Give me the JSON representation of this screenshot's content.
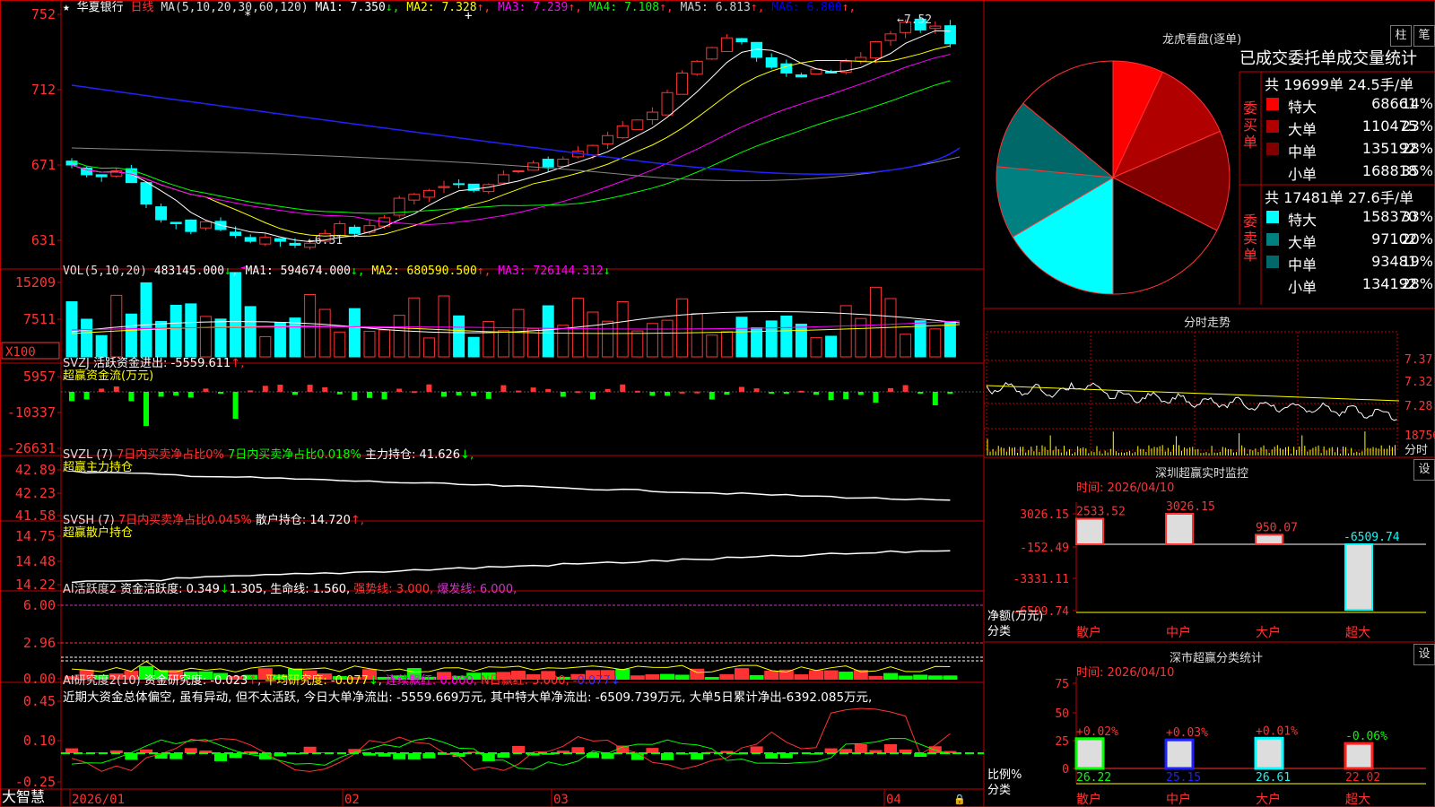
{
  "stock": {
    "name": "华夏银行",
    "period": "日线",
    "star": "★"
  },
  "colors": {
    "up": "#ff3333",
    "down": "#00ffff",
    "grid": "#c00000",
    "bg": "#000000",
    "ma1": "#ffffff",
    "ma2": "#ffff00",
    "ma3": "#ff00ff",
    "ma4": "#00ff00",
    "ma5": "#808080",
    "ma6": "#0000ff"
  },
  "main": {
    "ma_title": "MA(5,10,20,30,60,120)",
    "ma": [
      {
        "label": "MA1:",
        "value": "7.350",
        "arrow": "↓",
        "color": "#ffffff"
      },
      {
        "label": "MA2:",
        "value": "7.328",
        "arrow": "↑",
        "color": "#ffff00"
      },
      {
        "label": "MA3:",
        "value": "7.239",
        "arrow": "↑",
        "color": "#ff00ff"
      },
      {
        "label": "MA4:",
        "value": "7.108",
        "arrow": "↑",
        "color": "#00ff00"
      },
      {
        "label": "MA5:",
        "value": "6.813",
        "arrow": "↑",
        "color": "#cccccc"
      },
      {
        "label": "MA6:",
        "value": "6.800",
        "arrow": "↑",
        "color": "#0000ff"
      }
    ],
    "yticks": [
      "752",
      "712",
      "671",
      "631"
    ],
    "hi_mark": "7.52",
    "lo_mark": "6.31"
  },
  "vol": {
    "title": "VOL(5,10,20)",
    "value": "483145.000",
    "arrow": "↓",
    "ma": [
      {
        "label": "MA1:",
        "value": "594674.000",
        "arrow": "↓",
        "color": "#ffffff"
      },
      {
        "label": "MA2:",
        "value": "680590.500",
        "arrow": "↑",
        "color": "#ffff00"
      },
      {
        "label": "MA3:",
        "value": "726144.312",
        "arrow": "↓",
        "color": "#ff00ff"
      }
    ],
    "yticks": [
      "15209",
      "7511",
      "X100"
    ]
  },
  "svzj": {
    "title": "SVZJ",
    "label": "活跃资金进出:",
    "value": "-5559.611",
    "arrow": "↑,",
    "sub": "超赢资金流(万元)",
    "yticks": [
      "5957",
      "-10337",
      "-26631"
    ]
  },
  "svzl": {
    "title": "SVZL (7)",
    "t1": "7日内买卖净占比0%",
    "t2": "7日内买卖净占比0.018%",
    "t3": "主力持仓:",
    "value": "41.626",
    "arrow": "↓,",
    "sub": "超赢主力持仓",
    "yticks": [
      "42.89",
      "42.23",
      "41.58"
    ]
  },
  "svsh": {
    "title": "SVSH (7)",
    "t1": "7日内买卖净占比0.045%",
    "t3": "散户持仓:",
    "value": "14.720",
    "arrow": "↑,",
    "sub": "超赢散户持仓",
    "yticks": [
      "14.75",
      "14.48",
      "14.22"
    ]
  },
  "ai1": {
    "title": "AI活跃度2",
    "a": "资金活跃度: 0.349",
    "a_arrow": "↓",
    "b": "1.305,",
    "c": "生命线: 1.560,",
    "d": "强势线: 3.000,",
    "e": "爆发线: 6.000,",
    "yticks": [
      "6.00",
      "2.96",
      "0.00"
    ]
  },
  "ai2": {
    "title": "AI研究度2(10)",
    "a": "资金研究度: -0.023",
    "a_arrow": "↑",
    "b": "平均研究度: -0.077",
    "b_arrow": "↓",
    "c": "连续飘红: 0.000,",
    "d": "N日飘红: 5.000,",
    "e": "-0.077",
    "e_arrow": "↓",
    "comment": "近期大资金总体偏空, 虽有异动, 但不太活跃, 今日大单净流出: -5559.669万元, 其中特大单净流出: -6509.739万元, 大单5日累计净出-6392.085万元,",
    "yticks": [
      "0.45",
      "0.10",
      "-0.25"
    ]
  },
  "xaxis": {
    "labels": [
      "2026/01",
      "02",
      "03",
      "04"
    ]
  },
  "footer": {
    "brand": "大智慧"
  },
  "right": {
    "btn_zhu": "柱",
    "btn_bi": "笔",
    "lhk_title": "龙虎看盘(逐单)",
    "table_header": "已成交委托单成交量统计",
    "buy": {
      "side": "委买单",
      "summary": "共 19699单 24.5手/单",
      "rows": [
        {
          "name": "特大",
          "value": "68661",
          "pct": "14%",
          "color": "#ff0000"
        },
        {
          "name": "大单",
          "value": "110475",
          "pct": "23%",
          "color": "#b00000"
        },
        {
          "name": "中单",
          "value": "135192",
          "pct": "28%",
          "color": "#800000"
        },
        {
          "name": "小单",
          "value": "168818",
          "pct": "35%",
          "color": "#000000"
        }
      ]
    },
    "sell": {
      "side": "委卖单",
      "summary": "共 17481单 27.6手/单",
      "rows": [
        {
          "name": "特大",
          "value": "158370",
          "pct": "33%",
          "color": "#00ffff"
        },
        {
          "name": "大单",
          "value": "97102",
          "pct": "20%",
          "color": "#008080"
        },
        {
          "name": "中单",
          "value": "93481",
          "pct": "19%",
          "color": "#006868"
        },
        {
          "name": "小单",
          "value": "134192",
          "pct": "28%",
          "color": "#000000"
        }
      ]
    },
    "fs_title": "分时走势",
    "fs_ticks": [
      "7.37",
      "7.32",
      "7.28",
      "18756"
    ],
    "fs_label": "分时",
    "mon_title": "深圳超赢实时监控",
    "mon_time": "时间: 2026/04/10",
    "mon_yticks": [
      "3026.15",
      "-152.49",
      "-3331.11",
      "-6509.74"
    ],
    "mon_ylabel": "净额(万元)",
    "mon_bars": [
      {
        "label": "2533.52",
        "value": 2533.52
      },
      {
        "label": "3026.15",
        "value": 3026.15
      },
      {
        "label": "950.07",
        "value": 950.07
      },
      {
        "label": "-6509.74",
        "value": -6509.74
      }
    ],
    "mon_cats": [
      "散户",
      "中户",
      "大户",
      "超大"
    ],
    "mon_cat_label": "分类",
    "cls_title": "深市超赢分类统计",
    "cls_time": "时间: 2026/04/10",
    "cls_yticks": [
      "75",
      "50",
      "25",
      "0"
    ],
    "cls_ylabel": "比例%",
    "cls_cat_label": "分类",
    "cls_bars": [
      {
        "top": "+0.02%",
        "value": 26.22,
        "label": "26.22",
        "color": "#00ff00"
      },
      {
        "top": "+0.03%",
        "value": 25.15,
        "label": "25.15",
        "color": "#2020ff"
      },
      {
        "top": "+0.01%",
        "value": 26.61,
        "label": "26.61",
        "color": "#00ffff"
      },
      {
        "top": "-0.06%",
        "value": 22.02,
        "label": "22.02",
        "color": "#ff2020"
      }
    ],
    "cls_cats": [
      "散户",
      "中户",
      "大户",
      "超大"
    ],
    "btn_set": "设"
  }
}
